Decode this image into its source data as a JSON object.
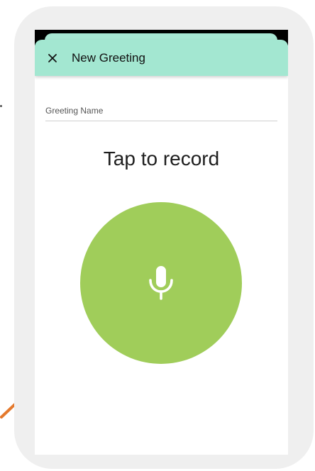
{
  "app_bar": {
    "title": "New Greeting",
    "close_icon": "close-icon",
    "color": "#a3e7d1"
  },
  "greeting_name_field": {
    "placeholder": "Greeting Name",
    "value": ""
  },
  "recorder": {
    "prompt": "Tap to record",
    "button_icon": "microphone-icon",
    "button_color": "#a0cd5a"
  }
}
